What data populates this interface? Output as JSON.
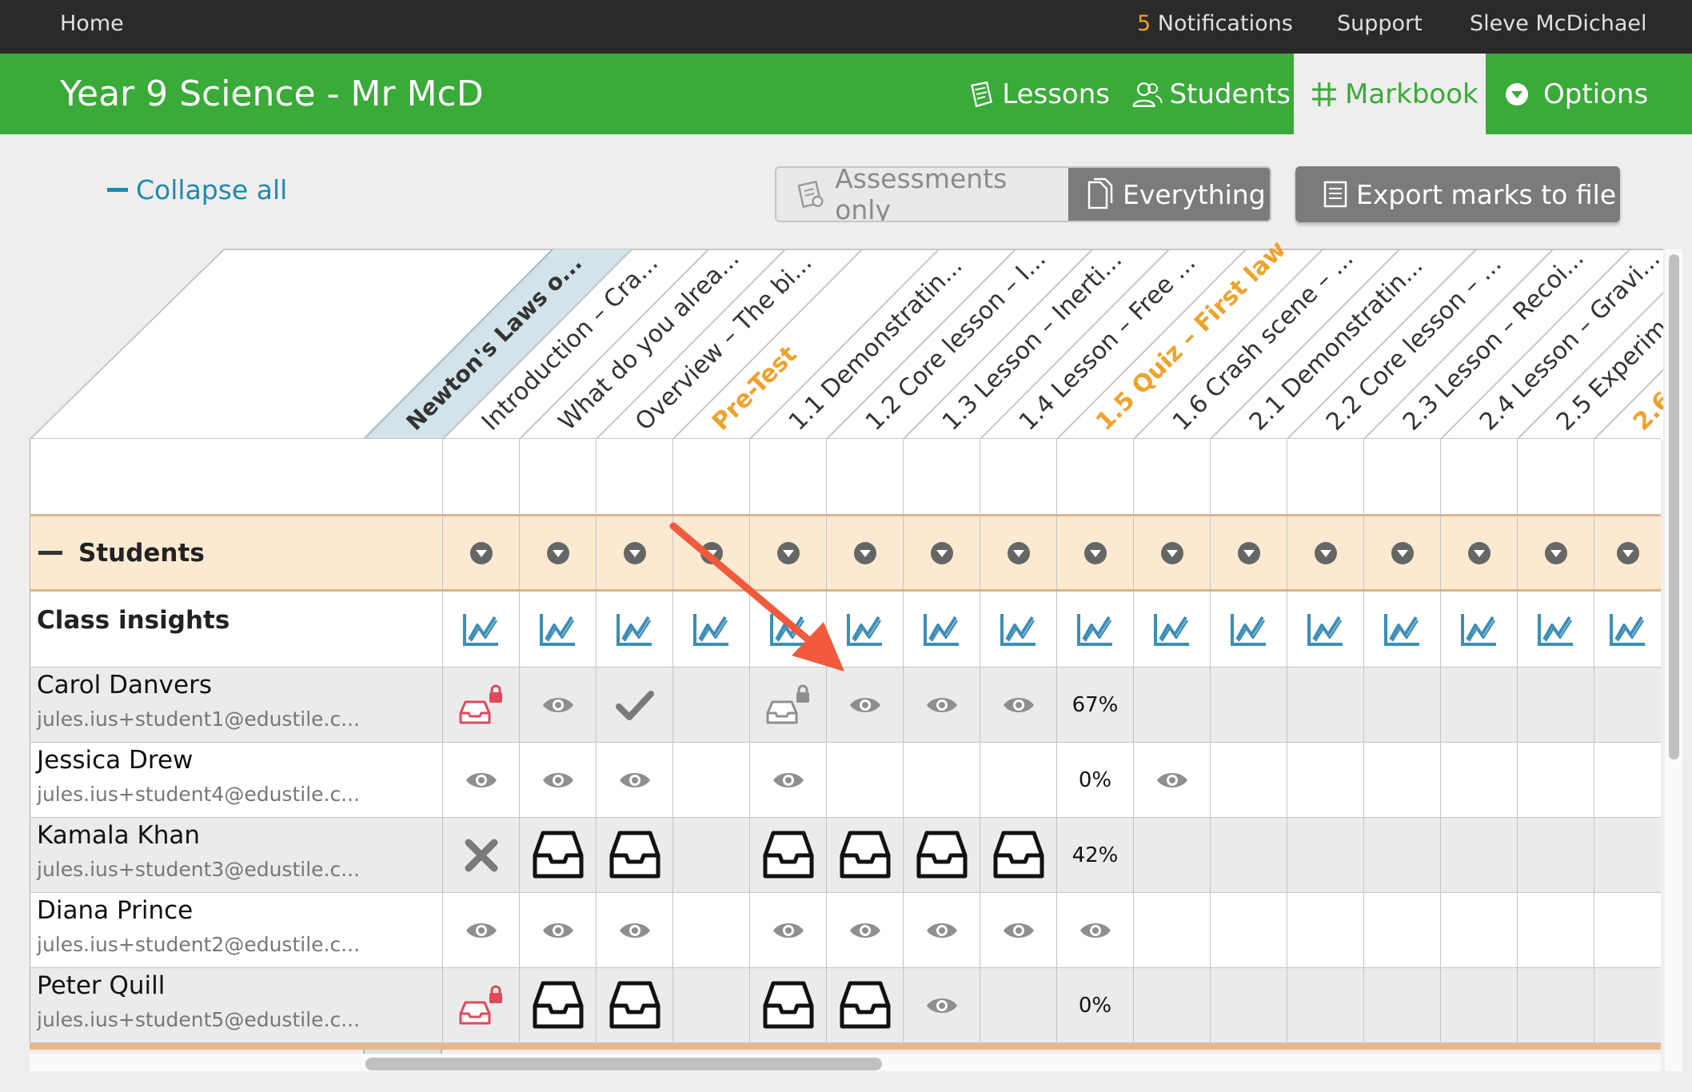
{
  "topbar": {
    "home": "Home",
    "notifications_count": "5",
    "notifications": "Notifications",
    "support": "Support",
    "user": "Sleve McDichael"
  },
  "class": {
    "title": "Year 9 Science - Mr McD",
    "nav": [
      {
        "label": "Lessons",
        "icon": "lessons-icon"
      },
      {
        "label": "Students",
        "icon": "students-icon"
      },
      {
        "label": "Markbook",
        "icon": "grid-icon",
        "active": true
      },
      {
        "label": "Options",
        "icon": "chevron-down-circle-icon"
      }
    ]
  },
  "controls": {
    "collapse_all": "Collapse all",
    "assessments_only": "Assessments only",
    "everything": "Everything",
    "export": "Export marks to file"
  },
  "colors": {
    "green": "#3aaa39",
    "orange": "#f0a22b",
    "blue_link": "#1d8ab0",
    "insight_icon": "#3c8eb8",
    "locked_red": "#e0495b"
  },
  "unit": {
    "label": "Newton's Laws o..."
  },
  "columns": [
    {
      "label": "Introduction – Cra...",
      "highlight": false
    },
    {
      "label": "What do you alrea...",
      "highlight": false
    },
    {
      "label": "Overview – The bi...",
      "highlight": false
    },
    {
      "label": "Pre-Test",
      "highlight": true
    },
    {
      "label": "1.1 Demonstratin...",
      "highlight": false
    },
    {
      "label": "1.2 Core lesson – I...",
      "highlight": false
    },
    {
      "label": "1.3 Lesson – Inerti...",
      "highlight": false
    },
    {
      "label": "1.4 Lesson – Free ...",
      "highlight": false
    },
    {
      "label": "1.5 Quiz – First law",
      "highlight": true
    },
    {
      "label": "1.6 Crash scene – ...",
      "highlight": false
    },
    {
      "label": "2.1 Demonstratin...",
      "highlight": false
    },
    {
      "label": "2.2 Core lesson – ...",
      "highlight": false
    },
    {
      "label": "2.3 Lesson – Recoi...",
      "highlight": false
    },
    {
      "label": "2.4 Lesson – Gravi...",
      "highlight": false
    },
    {
      "label": "2.5 Experim",
      "highlight": false
    },
    {
      "label": "2.6",
      "highlight": true
    }
  ],
  "rows": {
    "students_label": "Students",
    "class_insights_label": "Class insights"
  },
  "students": [
    {
      "name": "Carol Danvers",
      "email": "jules.ius+student1@edustile.c...",
      "cells": [
        "locked-red",
        "eye",
        "check",
        "",
        "locked-grey",
        "eye",
        "eye",
        "eye",
        "67%",
        "",
        "",
        "",
        "",
        "",
        "",
        ""
      ]
    },
    {
      "name": "Jessica Drew",
      "email": "jules.ius+student4@edustile.c...",
      "cells": [
        "eye",
        "eye",
        "eye",
        "",
        "eye",
        "",
        "",
        "",
        "0%",
        "eye",
        "",
        "",
        "",
        "",
        "",
        ""
      ]
    },
    {
      "name": "Kamala Khan",
      "email": "jules.ius+student3@edustile.c...",
      "cells": [
        "cross",
        "inbox",
        "inbox",
        "",
        "inbox",
        "inbox",
        "inbox",
        "inbox",
        "42%",
        "",
        "",
        "",
        "",
        "",
        "",
        ""
      ]
    },
    {
      "name": "Diana Prince",
      "email": "jules.ius+student2@edustile.c...",
      "cells": [
        "eye",
        "eye",
        "eye",
        "",
        "eye",
        "eye",
        "eye",
        "eye",
        "eye",
        "",
        "",
        "",
        "",
        "",
        "",
        ""
      ]
    },
    {
      "name": "Peter Quill",
      "email": "jules.ius+student5@edustile.c...",
      "cells": [
        "locked-red",
        "inbox",
        "inbox",
        "",
        "inbox",
        "inbox",
        "eye",
        "",
        "0%",
        "",
        "",
        "",
        "",
        "",
        "",
        ""
      ]
    }
  ]
}
